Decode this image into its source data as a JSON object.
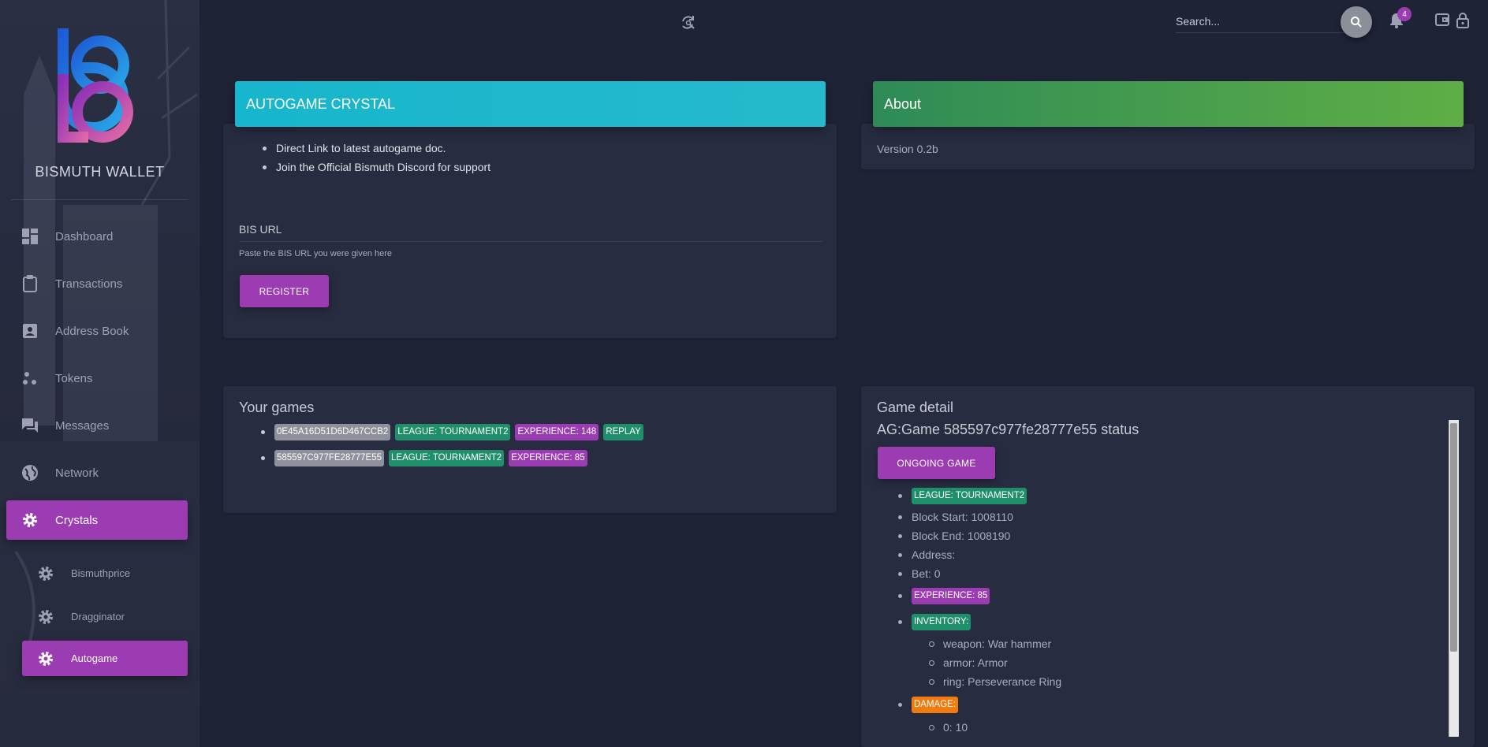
{
  "sidebar": {
    "brand": "BISMUTH WALLET",
    "items": [
      {
        "label": "Dashboard",
        "icon": "dashboard-icon"
      },
      {
        "label": "Transactions",
        "icon": "clipboard-icon"
      },
      {
        "label": "Address Book",
        "icon": "contact-book-icon"
      },
      {
        "label": "Tokens",
        "icon": "bubbles-icon"
      },
      {
        "label": "Messages",
        "icon": "forum-icon"
      },
      {
        "label": "Network",
        "icon": "globe-icon"
      },
      {
        "label": "Crystals",
        "icon": "gear-icon",
        "active": true
      }
    ],
    "sub_items": [
      {
        "label": "Bismuthprice",
        "icon": "gear-icon"
      },
      {
        "label": "Dragginator",
        "icon": "gear-icon"
      },
      {
        "label": "Autogame",
        "icon": "gear-icon",
        "active": true
      }
    ],
    "accent_color": "#9c3cb3"
  },
  "topbar": {
    "search_placeholder": "Search...",
    "notification_count": "4"
  },
  "autogame_card": {
    "title": "AUTOGAME CRYSTAL",
    "bullets": [
      "Direct Link to latest autogame doc.",
      "Join the Official Bismuth Discord for support"
    ],
    "field_label": "BIS URL",
    "field_help": "Paste the BIS URL you were given here",
    "register_label": "REGISTER"
  },
  "about_card": {
    "title": "About",
    "version": "Version 0.2b"
  },
  "games_card": {
    "title": "Your games",
    "games": [
      {
        "id": "0E45A16D51D6D467CCB2",
        "league": "LEAGUE: TOURNAMENT2",
        "experience": "EXPERIENCE: 148",
        "replay": "REPLAY"
      },
      {
        "id": "585597C977FE28777E55",
        "league": "LEAGUE: TOURNAMENT2",
        "experience": "EXPERIENCE: 85"
      }
    ]
  },
  "detail_card": {
    "title": "Game detail",
    "subtitle": "AG:Game 585597c977fe28777e55 status",
    "status_button": "ONGOING GAME",
    "league": "LEAGUE: TOURNAMENT2",
    "block_start": "Block Start: 1008110",
    "block_end": "Block End: 1008190",
    "address": "Address:",
    "bet": "Bet: 0",
    "experience": "EXPERIENCE: 85",
    "inventory_label": "INVENTORY:",
    "inventory": [
      "weapon: War hammer",
      "armor: Armor",
      "ring: Perseverance Ring"
    ],
    "damage_label": "DAMAGE:",
    "damage": [
      "0: 10"
    ]
  }
}
